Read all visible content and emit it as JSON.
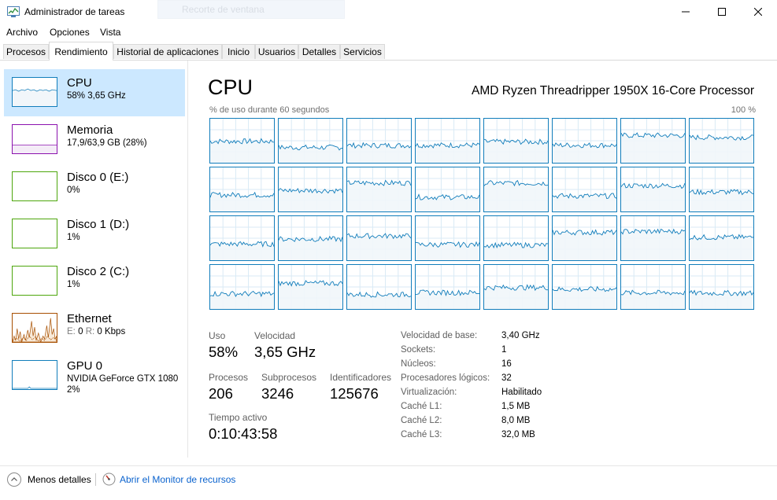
{
  "window": {
    "title": "Administrador de tareas",
    "ghost_text": "Recorte de ventana"
  },
  "menu": [
    "Archivo",
    "Opciones",
    "Vista"
  ],
  "tabs": [
    {
      "label": "Procesos"
    },
    {
      "label": "Rendimiento",
      "active": true
    },
    {
      "label": "Historial de aplicaciones"
    },
    {
      "label": "Inicio"
    },
    {
      "label": "Usuarios"
    },
    {
      "label": "Detalles"
    },
    {
      "label": "Servicios"
    }
  ],
  "sidebar": {
    "items": [
      {
        "name": "CPU",
        "sub": "58% 3,65 GHz",
        "selected": true,
        "color": "#117dbb"
      },
      {
        "name": "Memoria",
        "sub": "17,9/63,9 GB (28%)",
        "color": "#8b12ae"
      },
      {
        "name": "Disco 0 (E:)",
        "sub": "0%",
        "color": "#4da60c"
      },
      {
        "name": "Disco 1 (D:)",
        "sub": "1%",
        "color": "#4da60c"
      },
      {
        "name": "Disco 2 (C:)",
        "sub": "1%",
        "color": "#4da60c"
      },
      {
        "name": "Ethernet",
        "sub_e_label": "E:",
        "sub_e_value": "0",
        "sub_r_label": "R:",
        "sub_r_value": "0 Kbps",
        "color": "#a74f01"
      },
      {
        "name": "GPU 0",
        "sub": "NVIDIA GeForce GTX 1080",
        "sub2": "2%",
        "color": "#117dbb"
      }
    ]
  },
  "main": {
    "title": "CPU",
    "model": "AMD Ryzen Threadripper 1950X 16-Core Processor",
    "graph_label": "% de uso durante 60 segundos",
    "graph_max": "100 %",
    "core_count": 32,
    "core_color": "#117dbb",
    "stats": {
      "uso_label": "Uso",
      "uso_value": "58%",
      "velocidad_label": "Velocidad",
      "velocidad_value": "3,65 GHz",
      "procesos_label": "Procesos",
      "procesos_value": "206",
      "subprocesos_label": "Subprocesos",
      "subprocesos_value": "3246",
      "identificadores_label": "Identificadores",
      "identificadores_value": "125676",
      "tiempo_label": "Tiempo activo",
      "tiempo_value": "0:10:43:58"
    },
    "properties": [
      {
        "key": "Velocidad de base:",
        "value": "3,40 GHz"
      },
      {
        "key": "Sockets:",
        "value": "1"
      },
      {
        "key": "Núcleos:",
        "value": "16"
      },
      {
        "key": "Procesadores lógicos:",
        "value": "32"
      },
      {
        "key": "Virtualización:",
        "value": "Habilitado"
      },
      {
        "key": "Caché L1:",
        "value": "1,5 MB"
      },
      {
        "key": "Caché L2:",
        "value": "8,0 MB"
      },
      {
        "key": "Caché L3:",
        "value": "32,0 MB"
      }
    ]
  },
  "footer": {
    "fewer_details": "Menos detalles",
    "resource_monitor": "Abrir el Monitor de recursos"
  }
}
